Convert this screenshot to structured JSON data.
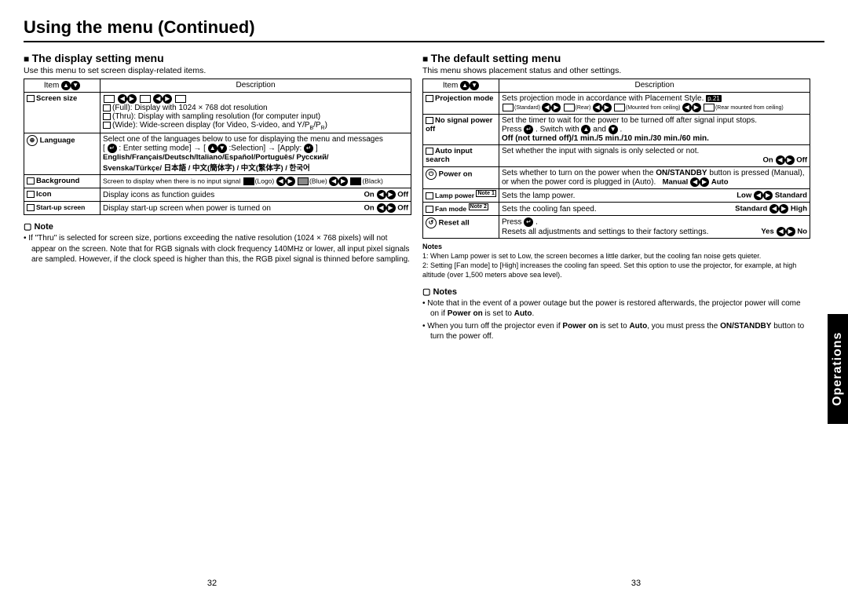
{
  "page_title": "Using the menu (Continued)",
  "side_tab": "Operations",
  "page_numbers": {
    "left": "32",
    "right": "33"
  },
  "left": {
    "heading": "The display setting menu",
    "intro": "Use this menu to set screen display-related items.",
    "table": {
      "item_header": "Item",
      "desc_header": "Description",
      "rows": {
        "screen_size": {
          "label": "Screen size",
          "full": "(Full):  Display with 1024 × 768 dot resolution",
          "thru": "(Thru): Display with sampling resolution (for computer input)",
          "wide": "(Wide):  Wide-screen display (for Video, S-video, and Y/P"
        },
        "language": {
          "label": "Language",
          "line1": "Select one of the languages below to use for displaying the menu and messages",
          "line2_pre": "[ ",
          "line2_enter": " : Enter setting mode] → [ ",
          "line2_sel": " :Selection] → [Apply: ",
          "line2_end": " ]",
          "lang1": "English/Français/Deutsch/Italiano/Español/Português/ Русский/",
          "lang2": "Svenska/Türkçe/ 日本語 / 中文(簡体字) / 中文(繁体字) / 한국어"
        },
        "background": {
          "label": "Background",
          "text_a": "Screen to display when there is no input signal ",
          "logo": "(Logo)",
          "blue": "(Blue)",
          "black": "(Black)"
        },
        "icon": {
          "label": "Icon",
          "text": "Display icons as function guides",
          "on": "On",
          "off": "Off"
        },
        "startup": {
          "label": "Start-up screen",
          "text": "Display start-up screen when power is turned on",
          "on": "On",
          "off": "Off"
        }
      }
    },
    "note_head": "Note",
    "note_body": "If \"Thru\" is selected for screen size, portions exceeding the native resolution (1024 × 768 pixels) will not appear on the screen. Note that for RGB signals with clock frequency 140MHz or lower, all input pixel signals are sampled. However, if the clock speed is higher than this, the RGB pixel signal is thinned before sampling."
  },
  "right": {
    "heading": "The default setting menu",
    "intro": "This menu shows placement status and other settings.",
    "table": {
      "item_header": "Item",
      "desc_header": "Description",
      "rows": {
        "projection": {
          "label": "Projection mode",
          "text": "Sets projection mode in accordance with Placement Style.",
          "pref": "p.21",
          "std": "(Standard)",
          "rear": "(Rear)",
          "mfc": "(Mounted from ceiling)",
          "rmfc": "(Rear mounted from ceiling)"
        },
        "nosignal": {
          "label": "No signal power off",
          "text1": "Set the timer to wait for the power to be turned off after signal input stops.",
          "text2a": "Press ",
          "text2b": " . Switch with ",
          "text2c": " and ",
          "text2d": " .",
          "opts": "Off (not turned off)/1 min./5 min./10 min./30 min./60 min."
        },
        "autoinput": {
          "label": "Auto input search",
          "text": "Set whether the input with signals is only selected or not.",
          "on": "On",
          "off": "Off"
        },
        "poweron": {
          "label": "Power on",
          "text_a": "Sets whether to turn on the power when the ",
          "text_b": "ON/STANDBY",
          "text_c": " button is pressed (Manual), or when the power cord is plugged in (Auto).",
          "manual": "Manual",
          "auto": "Auto"
        },
        "lamp": {
          "label": "Lamp power",
          "note": "Note 1",
          "text": "Sets the lamp power.",
          "low": "Low",
          "std": "Standard"
        },
        "fan": {
          "label": "Fan mode",
          "note": "Note 2",
          "text": "Sets the cooling fan speed.",
          "std": "Standard",
          "high": "High"
        },
        "reset": {
          "label": "Reset all",
          "text1a": "Press ",
          "text1b": " .",
          "text2": "Resets all adjustments and settings to their factory settings.",
          "yes": "Yes",
          "no": "No"
        }
      }
    },
    "small_notes_head": "Notes",
    "small_notes": {
      "n1": "1: When Lamp power is set to Low, the screen becomes a little darker, but the cooling fan noise gets quieter.",
      "n2": "2: Setting [Fan mode] to [High] increases the cooling fan speed. Set this option to use the projector, for example, at high altitude (over 1,500 meters above sea level)."
    },
    "notes_head": "Notes",
    "note_bullets": {
      "b1a": "Note that in the event of a power outage but the power is restored afterwards, the projector power will come on if ",
      "b1b": "Power on",
      "b1c": " is set to ",
      "b1d": "Auto",
      "b1e": ".",
      "b2a": "When you turn off the projector even if ",
      "b2b": "Power on",
      "b2c": " is set to ",
      "b2d": "Auto",
      "b2e": ", you must press the ",
      "b2f": "ON/STANDBY",
      "b2g": " button to turn the power off."
    }
  }
}
